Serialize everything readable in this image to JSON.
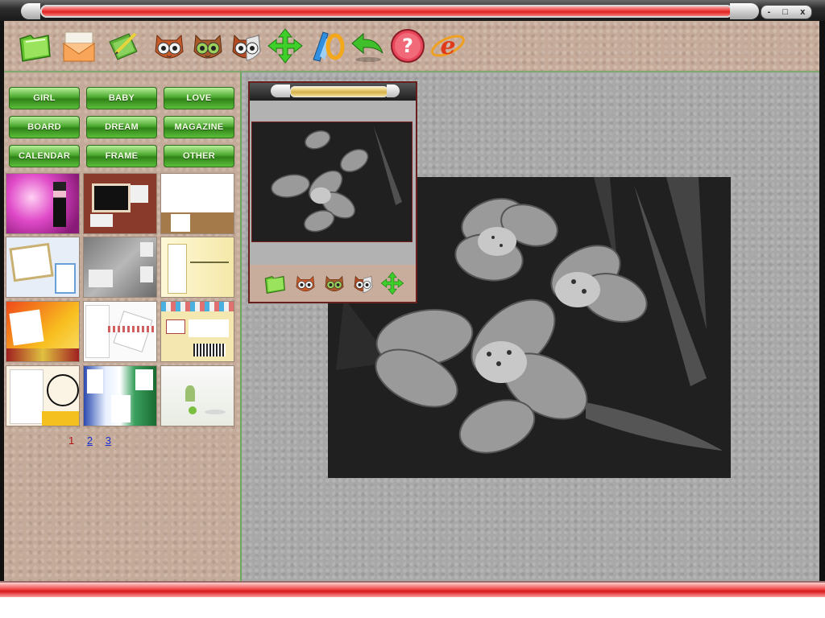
{
  "window": {
    "controls": {
      "minimize": "-",
      "maximize": "□",
      "close": "x"
    }
  },
  "toolbar": {
    "buttons": [
      {
        "name": "open-folder-icon"
      },
      {
        "name": "envelope-icon"
      },
      {
        "name": "pencil-paper-icon"
      },
      {
        "name": "owl-face-icon"
      },
      {
        "name": "owl-face-green-icon"
      },
      {
        "name": "owl-face-half-icon"
      },
      {
        "name": "move-arrows-icon"
      },
      {
        "name": "paint-tools-icon"
      },
      {
        "name": "undo-arrow-icon"
      },
      {
        "name": "help-icon"
      },
      {
        "name": "internet-explorer-icon"
      }
    ]
  },
  "categories": {
    "row1": [
      "GIRL",
      "BABY",
      "LOVE"
    ],
    "row2": [
      "BOARD",
      "DREAM",
      "MAGAZINE"
    ],
    "row3": [
      "CALENDAR",
      "FRAME",
      "OTHER"
    ]
  },
  "pager": {
    "current": "1",
    "page2": "2",
    "page3": "3"
  },
  "preview": {
    "tools": [
      {
        "name": "folder-icon"
      },
      {
        "name": "owl-face-icon"
      },
      {
        "name": "owl-face-green-icon"
      },
      {
        "name": "owl-face-half-icon"
      },
      {
        "name": "move-arrows-icon"
      }
    ]
  },
  "colors": {
    "accent_red": "#e02222",
    "button_green": "#4ca82e",
    "panel_tan": "#c4aa99",
    "canvas_gray": "#a8a8a8"
  }
}
